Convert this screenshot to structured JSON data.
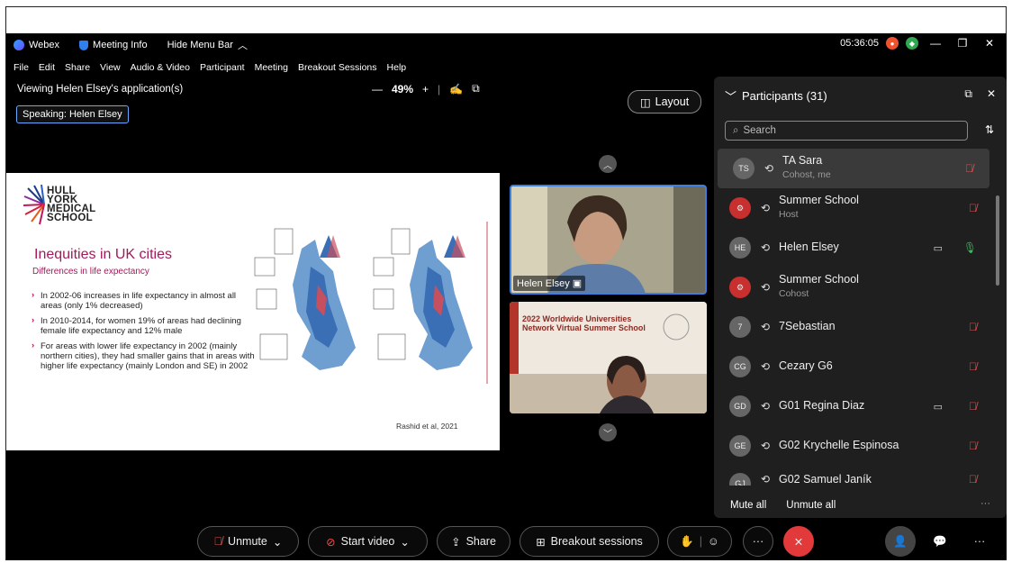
{
  "topbar": {
    "app_name": "Webex",
    "meeting_info": "Meeting Info",
    "hide_menu": "Hide Menu Bar",
    "clock": "05:36:05"
  },
  "menu": [
    "File",
    "Edit",
    "Share",
    "View",
    "Audio & Video",
    "Participant",
    "Meeting",
    "Breakout Sessions",
    "Help"
  ],
  "share": {
    "viewing_text": "Viewing Helen Elsey's application(s)",
    "zoom_level": "49%",
    "speaking": "Speaking: Helen Elsey"
  },
  "slide": {
    "logo_lines": [
      "HULL",
      "YORK",
      "MEDICAL",
      "SCHOOL"
    ],
    "title": "Inequities in UK cities",
    "subtitle": "Differences in life expectancy",
    "bullets": [
      "In 2002-06 increases in life expectancy in almost all areas (only 1% decreased)",
      "In 2010-2014, for women 19% of areas had declining female life expectancy and 12% male",
      "For areas with lower life expectancy in 2002 (mainly northern cities), they had smaller gains that in areas with higher life expectancy  (mainly London and SE) in 2002"
    ],
    "reference": "Rashid et al, 2021"
  },
  "layout_label": "Layout",
  "videos": {
    "speaker_name": "Helen Elsey",
    "second_title": "2022 Worldwide Universities Network Virtual Summer School"
  },
  "participants": {
    "header": "Participants (31)",
    "search_placeholder": "Search",
    "list": [
      {
        "initials": "TS",
        "name": "TA Sara",
        "role": "Cohost, me",
        "status": "muted",
        "video": false,
        "org": false
      },
      {
        "initials": "",
        "name": "Summer School",
        "role": "Host",
        "status": "muted",
        "video": false,
        "org": true
      },
      {
        "initials": "HE",
        "name": "Helen Elsey",
        "role": "",
        "status": "on",
        "video": true,
        "org": false
      },
      {
        "initials": "",
        "name": "Summer School",
        "role": "Cohost",
        "status": "none",
        "video": false,
        "org": true
      },
      {
        "initials": "7",
        "name": "7Sebastian",
        "role": "",
        "status": "muted",
        "video": false,
        "org": false
      },
      {
        "initials": "CG",
        "name": "Cezary G6",
        "role": "",
        "status": "muted",
        "video": false,
        "org": false
      },
      {
        "initials": "GD",
        "name": "G01 Regina Diaz",
        "role": "",
        "status": "muted",
        "video": true,
        "org": false
      },
      {
        "initials": "GE",
        "name": "G02 Krychelle Espinosa",
        "role": "",
        "status": "muted",
        "video": false,
        "org": false
      },
      {
        "initials": "GJ",
        "name": "G02 Samuel Janík",
        "role": "",
        "status": "muted",
        "video": false,
        "org": false
      }
    ],
    "mute_all": "Mute all",
    "unmute_all": "Unmute all"
  },
  "controls": {
    "unmute": "Unmute",
    "start_video": "Start video",
    "share": "Share",
    "breakout": "Breakout sessions"
  }
}
